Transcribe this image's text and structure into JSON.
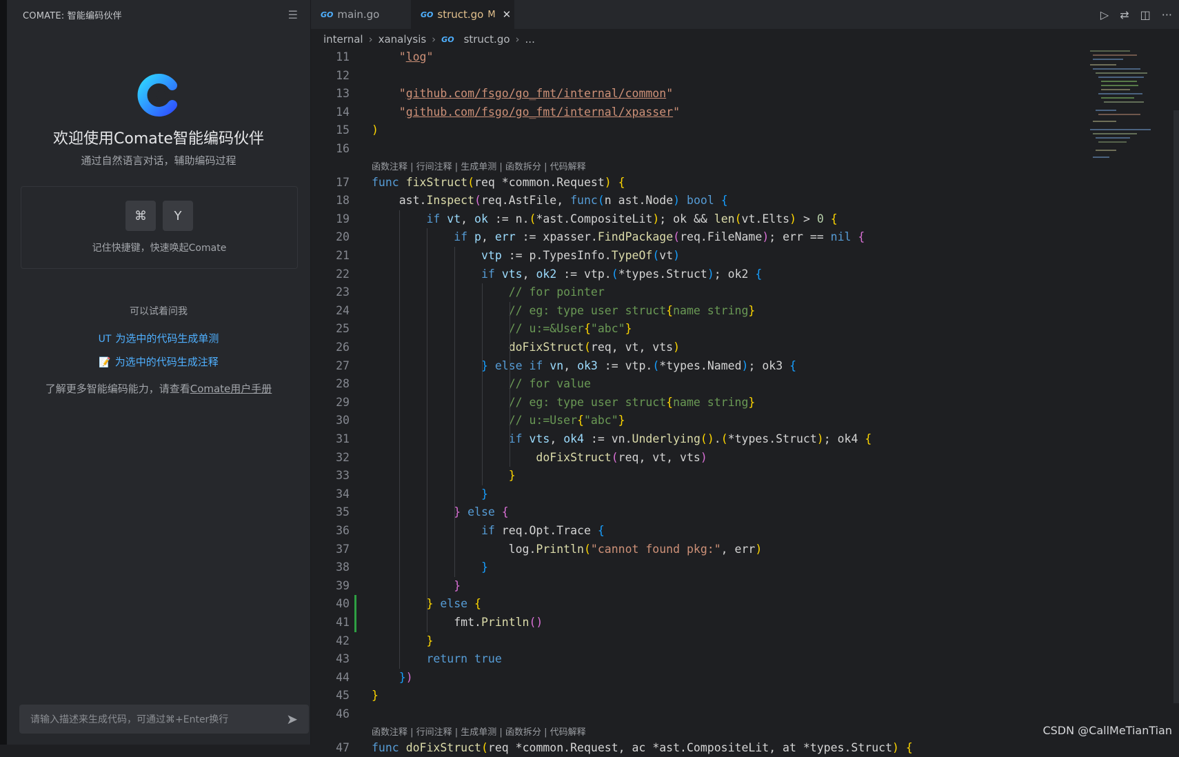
{
  "sidebar": {
    "title": "COMATE: 智能编码伙伴",
    "welcome_title": "欢迎使用Comate智能编码伙伴",
    "welcome_subtitle": "通过自然语言对话，辅助编码过程",
    "shortcut_keys": [
      "⌘",
      "Y"
    ],
    "shortcut_hint": "记住快捷键，快速唤起Comate",
    "try_label": "可以试着问我",
    "suggestions": [
      "为选中的代码生成单测",
      "为选中的代码生成注释"
    ],
    "suggestion_icons": [
      "UT",
      "📝"
    ],
    "learn_prefix": "了解更多智能编码能力，请查看",
    "learn_link": "Comate用户手册",
    "input_placeholder": "请输入描述来生成代码，可通过⌘+Enter换行"
  },
  "tabs": [
    {
      "label": "main.go",
      "active": false
    },
    {
      "label": "struct.go",
      "active": true,
      "badge": "M"
    }
  ],
  "breadcrumb": [
    "internal",
    "xanalysis",
    "struct.go",
    "..."
  ],
  "codelens_text": "函数注释 | 行间注释 | 生成单测 | 函数拆分 | 代码解释",
  "code_lines": [
    {
      "n": "11",
      "html": "    <span class=\"str\">\"<span class=\"strl\">log</span>\"</span>"
    },
    {
      "n": "12",
      "html": ""
    },
    {
      "n": "13",
      "html": "    <span class=\"str\">\"<span class=\"strl\">github.com/fsgo/go_fmt/internal/common</span>\"</span>"
    },
    {
      "n": "14",
      "html": "    <span class=\"str\">\"<span class=\"strl\">github.com/fsgo/go_fmt/internal/xpasser</span>\"</span>"
    },
    {
      "n": "15",
      "html": "<span class=\"bk\">)</span>"
    },
    {
      "n": "16",
      "html": ""
    },
    {
      "n": "17",
      "html": "<span class=\"kw\">func</span> <span class=\"fn\">fixStruct</span><span class=\"bk\">(</span>req *common.Request<span class=\"bk\">)</span> <span class=\"bk\">{</span>"
    },
    {
      "n": "18",
      "html": "    ast.<span class=\"fn\">Inspect</span><span class=\"bk2\">(</span>req.AstFile, <span class=\"kw\">func</span><span class=\"bk3\">(</span>n ast.Node<span class=\"bk3\">)</span> <span class=\"kw\">bool</span> <span class=\"bk3\">{</span>"
    },
    {
      "n": "19",
      "html": "        <span class=\"kw\">if</span> <span class=\"var\">vt</span>, <span class=\"var\">ok</span> := n.<span class=\"bk\">(</span>*ast.CompositeLit<span class=\"bk\">)</span>; ok &amp;&amp; <span class=\"fn\">len</span><span class=\"bk\">(</span>vt.Elts<span class=\"bk\">)</span> &gt; <span class=\"num\">0</span> <span class=\"bk\">{</span>"
    },
    {
      "n": "20",
      "html": "            <span class=\"kw\">if</span> <span class=\"var\">p</span>, <span class=\"var\">err</span> := xpasser.<span class=\"fn\">FindPackage</span><span class=\"bk2\">(</span>req.FileName<span class=\"bk2\">)</span>; err == <span class=\"kw\">nil</span> <span class=\"bk2\">{</span>"
    },
    {
      "n": "21",
      "html": "                <span class=\"var\">vtp</span> := p.TypesInfo.<span class=\"fn\">TypeOf</span><span class=\"bk3\">(</span>vt<span class=\"bk3\">)</span>"
    },
    {
      "n": "22",
      "html": "                <span class=\"kw\">if</span> <span class=\"var\">vts</span>, <span class=\"var\">ok2</span> := vtp.<span class=\"bk3\">(</span>*types.Struct<span class=\"bk3\">)</span>; ok2 <span class=\"bk3\">{</span>"
    },
    {
      "n": "23",
      "html": "                    <span class=\"cm\">// for pointer</span>"
    },
    {
      "n": "24",
      "html": "                    <span class=\"cm\">// eg: type user struct<span class=\"bk\">{</span>name string<span class=\"bk\">}</span></span>"
    },
    {
      "n": "25",
      "html": "                    <span class=\"cm\">// u:=&amp;User<span class=\"bk\">{</span>\"abc\"<span class=\"bk\">}</span></span>"
    },
    {
      "n": "26",
      "html": "                    <span class=\"fn\">doFixStruct</span><span class=\"bk\">(</span>req, vt, vts<span class=\"bk\">)</span>"
    },
    {
      "n": "27",
      "html": "                <span class=\"bk3\">}</span> <span class=\"kw\">else if</span> <span class=\"var\">vn</span>, <span class=\"var\">ok3</span> := vtp.<span class=\"bk3\">(</span>*types.Named<span class=\"bk3\">)</span>; ok3 <span class=\"bk3\">{</span>"
    },
    {
      "n": "28",
      "html": "                    <span class=\"cm\">// for value</span>"
    },
    {
      "n": "29",
      "html": "                    <span class=\"cm\">// eg: type user struct<span class=\"bk\">{</span>name string<span class=\"bk\">}</span></span>"
    },
    {
      "n": "30",
      "html": "                    <span class=\"cm\">// u:=User<span class=\"bk\">{</span>\"abc\"<span class=\"bk\">}</span></span>"
    },
    {
      "n": "31",
      "html": "                    <span class=\"kw\">if</span> <span class=\"var\">vts</span>, <span class=\"var\">ok4</span> := vn.<span class=\"fn\">Underlying</span><span class=\"bk\">()</span>.<span class=\"bk\">(</span>*types.Struct<span class=\"bk\">)</span>; ok4 <span class=\"bk\">{</span>"
    },
    {
      "n": "32",
      "html": "                        <span class=\"fn\">doFixStruct</span><span class=\"bk2\">(</span>req, vt, vts<span class=\"bk2\">)</span>"
    },
    {
      "n": "33",
      "html": "                    <span class=\"bk\">}</span>"
    },
    {
      "n": "34",
      "html": "                <span class=\"bk3\">}</span>"
    },
    {
      "n": "35",
      "html": "            <span class=\"bk2\">}</span> <span class=\"kw\">else</span> <span class=\"bk2\">{</span>"
    },
    {
      "n": "36",
      "html": "                <span class=\"kw\">if</span> req.Opt.Trace <span class=\"bk3\">{</span>"
    },
    {
      "n": "37",
      "html": "                    log.<span class=\"fn\">Println</span><span class=\"bk\">(</span><span class=\"str\">\"cannot found pkg:\"</span>, err<span class=\"bk\">)</span>"
    },
    {
      "n": "38",
      "html": "                <span class=\"bk3\">}</span>"
    },
    {
      "n": "39",
      "html": "            <span class=\"bk2\">}</span>"
    },
    {
      "n": "40",
      "html": "        <span class=\"bk\">}</span> <span class=\"kw\">else</span> <span class=\"bk\">{</span>"
    },
    {
      "n": "41",
      "html": "            fmt.<span class=\"fn\">Println</span><span class=\"bk2\">()</span>"
    },
    {
      "n": "42",
      "html": "        <span class=\"bk\">}</span>"
    },
    {
      "n": "43",
      "html": "        <span class=\"kw\">return</span> <span class=\"kw\">true</span>"
    },
    {
      "n": "44",
      "html": "    <span class=\"bk3\">}</span><span class=\"bk2\">)</span>"
    },
    {
      "n": "45",
      "html": "<span class=\"bk\">}</span>"
    },
    {
      "n": "46",
      "html": ""
    },
    {
      "n": "47",
      "html": "<span class=\"kw\">func</span> <span class=\"fn\">doFixStruct</span><span class=\"bk\">(</span>req *common.Request, ac *ast.CompositeLit, at *types.Struct<span class=\"bk\">)</span> <span class=\"bk\">{</span>"
    }
  ],
  "watermark": "CSDN @CallMeTianTian",
  "colors": {
    "accent": "#4fb0ff",
    "modified": "#e2c08d",
    "git_added": "#2ea043"
  }
}
